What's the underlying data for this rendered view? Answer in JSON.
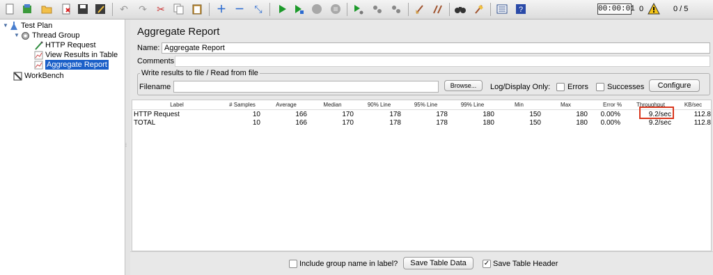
{
  "toolbar": {
    "buttons": [
      "new-icon",
      "templates-icon",
      "open-icon",
      "close-icon",
      "save-icon",
      "save-as-icon",
      "undo-icon",
      "redo-icon",
      "cut-icon",
      "copy-icon",
      "paste-icon",
      "expand-icon",
      "collapse-icon",
      "toggle-icon",
      "start-icon",
      "start-no-pause-icon",
      "stop-icon",
      "shutdown-icon",
      "remote-start-icon",
      "remote-stop-icon",
      "remote-shutdown-icon",
      "clear-icon",
      "clear-all-icon",
      "search-icon",
      "reset-search-icon",
      "function-helper-icon",
      "help-icon"
    ],
    "timer": "00:00:01",
    "error_count": "0",
    "threads": "0 / 5"
  },
  "tree": {
    "test_plan": "Test Plan",
    "thread_group": "Thread Group",
    "http_request": "HTTP Request",
    "view_results_table": "View Results in Table",
    "aggregate_report": "Aggregate Report",
    "workbench": "WorkBench"
  },
  "panel": {
    "title": "Aggregate Report",
    "name_label": "Name:",
    "name_value": "Aggregate Report",
    "comments_label": "Comments:",
    "comments_value": "",
    "file_section_title": "Write results to file / Read from file",
    "filename_label": "Filename",
    "filename_value": "",
    "browse_label": "Browse...",
    "log_display_label": "Log/Display Only:",
    "errors_label": "Errors",
    "successes_label": "Successes",
    "configure_label": "Configure"
  },
  "table": {
    "headers": [
      "Label",
      "# Samples",
      "Average",
      "Median",
      "90% Line",
      "95% Line",
      "99% Line",
      "Min",
      "Max",
      "Error %",
      "Throughput",
      "KB/sec"
    ],
    "rows": [
      [
        "HTTP Request",
        "10",
        "166",
        "170",
        "178",
        "178",
        "180",
        "150",
        "180",
        "0.00%",
        "9.2/sec",
        "112.8"
      ],
      [
        "TOTAL",
        "10",
        "166",
        "170",
        "178",
        "178",
        "180",
        "150",
        "180",
        "0.00%",
        "9.2/sec",
        "112.8"
      ]
    ]
  },
  "bottom": {
    "include_group_label": "Include group name in label?",
    "include_group_checked": false,
    "save_table_data_label": "Save Table Data",
    "save_table_header_label": "Save Table Header",
    "save_table_header_checked": true
  },
  "colors": {
    "selection": "#1a5fc8",
    "highlight_box": "#d9361c",
    "start_green": "#1c9a2a"
  }
}
